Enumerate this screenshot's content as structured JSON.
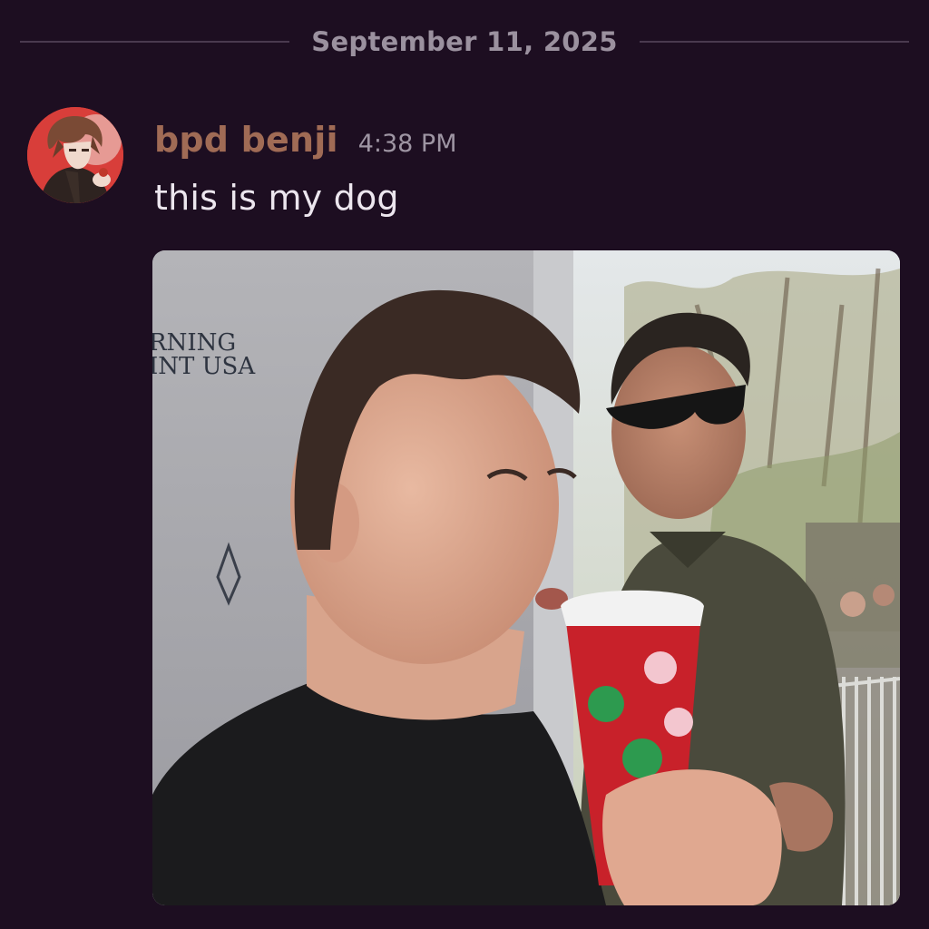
{
  "divider": {
    "date": "September 11, 2025"
  },
  "message": {
    "username": "bpd benji",
    "timestamp": "4:38 PM",
    "text": "this is my dog",
    "avatar_icon": "anime-character-avatar",
    "attachment_icon": "video-still-image",
    "attachment_backdrop_text_1": "RNING",
    "attachment_backdrop_text_2": "INT USA"
  },
  "colors": {
    "background": "#1d0e21",
    "username": "#a06b55",
    "timestamp": "#9e95a3",
    "text": "#ece6ee",
    "divider_text": "#9b919f"
  }
}
